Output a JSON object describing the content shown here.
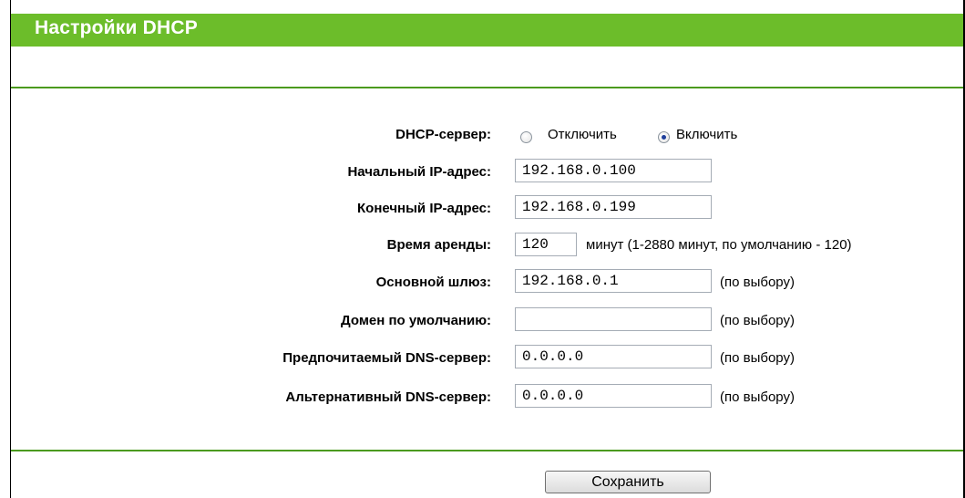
{
  "header": {
    "title": "Настройки DHCP"
  },
  "dhcp_server": {
    "label": "DHCP-сервер:",
    "options": [
      {
        "label": "Отключить",
        "selected": false
      },
      {
        "label": "Включить",
        "selected": true
      }
    ]
  },
  "start_ip": {
    "label": "Начальный IP-адрес:",
    "value": "192.168.0.100"
  },
  "end_ip": {
    "label": "Конечный IP-адрес:",
    "value": "192.168.0.199"
  },
  "lease_time": {
    "label": "Время аренды:",
    "value": "120",
    "note": "минут (1-2880 минут, по умолчанию - 120)"
  },
  "gateway": {
    "label": "Основной шлюз:",
    "value": "192.168.0.1",
    "note": "(по выбору)"
  },
  "default_domain": {
    "label": "Домен по умолчанию:",
    "value": "",
    "note": "(по выбору)"
  },
  "primary_dns": {
    "label": "Предпочитаемый DNS-сервер:",
    "value": "0.0.0.0",
    "note": "(по выбору)"
  },
  "secondary_dns": {
    "label": "Альтернативный DNS-сервер:",
    "value": "0.0.0.0",
    "note": "(по выбору)"
  },
  "save_button": {
    "label": "Сохранить"
  },
  "colors": {
    "header_bg": "#6cbd2a",
    "divider": "#4b9a1e",
    "radio_dot": "#1e3e9b"
  }
}
